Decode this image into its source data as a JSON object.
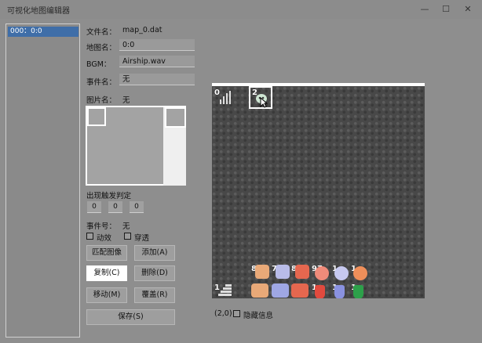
{
  "window": {
    "title": "可视化地图编辑器",
    "minimize": "—",
    "maximize": "☐",
    "close": "✕"
  },
  "list": {
    "items": [
      "000：0:0"
    ]
  },
  "props": {
    "file_label": "文件名：",
    "file_value": "map_0.dat",
    "mapname_label": "地图名：",
    "mapname_value": "0:0",
    "bgm_label": "BGM：",
    "bgm_value": "Airship.wav",
    "event_label": "事件名：",
    "event_value": "无",
    "image_label": "图片名：",
    "image_value": "无",
    "trigger_label": "出现触发判定",
    "trigger_values": [
      "0",
      "0",
      "0"
    ],
    "eventno_label": "事件号：",
    "eventno_value": "无",
    "anim_label": "动效",
    "pass_label": "穿透"
  },
  "buttons": {
    "match_image": "匹配图像",
    "add": "添加(A)",
    "copy": "复制(C)",
    "delete": "删除(D)",
    "move": "移动(M)",
    "cover": "覆盖(R)",
    "save": "保存(S)"
  },
  "map": {
    "hud_top_left": "0",
    "hud_top_sel": "2",
    "hud_bottom_left": "1",
    "row1_counts": [
      "8",
      "7",
      "8",
      "97",
      "1",
      "1"
    ],
    "row2_counts": [
      "3",
      "3",
      "5",
      "1",
      "1",
      "1"
    ],
    "coord": "(2,0)",
    "hide_label": "隐藏信息"
  },
  "colors": {
    "accent": "#3f6ea8",
    "map_bg": "#484848"
  }
}
